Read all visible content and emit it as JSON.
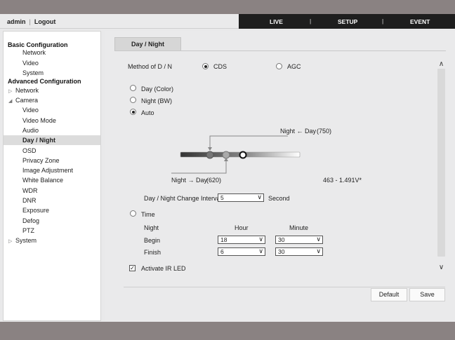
{
  "header": {
    "user": "admin",
    "logout": "Logout",
    "nav": [
      "LIVE",
      "SETUP",
      "EVENT"
    ],
    "nav_separator": "|",
    "nav_bg": "#1e1e1e"
  },
  "sidebar": {
    "basic_title": "Basic Configuration",
    "basic_items": [
      "Network",
      "Video",
      "System"
    ],
    "advanced_title": "Advanced Configuration",
    "network": "Network",
    "camera": "Camera",
    "camera_items": [
      "Video",
      "Video Mode",
      "Audio",
      "Day / Night",
      "OSD",
      "Privacy Zone",
      "Image Adjustment",
      "White Balance",
      "WDR",
      "DNR",
      "Exposure",
      "Defog",
      "PTZ"
    ],
    "system": "System",
    "active": "Day / Night"
  },
  "page": {
    "tab": "Day / Night",
    "method_label": "Method of D / N",
    "method_cds": "CDS",
    "method_agc": "AGC",
    "method_selected": "CDS",
    "mode_day": "Day (Color)",
    "mode_night": "Night (BW)",
    "mode_auto": "Auto",
    "mode_selected": "Auto",
    "threshold_upper_label": "Night ← Day",
    "threshold_upper_value": "(750)",
    "threshold_lower_label": "Night → Day",
    "threshold_lower_value": "(620)",
    "sensor_reading": "463 - 1.491V*",
    "interval_label": "Day / Night Change Interval",
    "interval_value": "5",
    "interval_unit": "Second",
    "mode_time": "Time",
    "col_night": "Night",
    "col_hour": "Hour",
    "col_minute": "Minute",
    "begin_label": "Begin",
    "begin_hour": "18",
    "begin_minute": "30",
    "finish_label": "Finish",
    "finish_hour": "6",
    "finish_minute": "30",
    "ir_led_label": "Activate IR LED",
    "ir_led_checked": "✓",
    "default_button": "Default",
    "save_button": "Save"
  },
  "colors": {
    "top_band": "#8a8282",
    "active_item": "#dcdcdc"
  }
}
